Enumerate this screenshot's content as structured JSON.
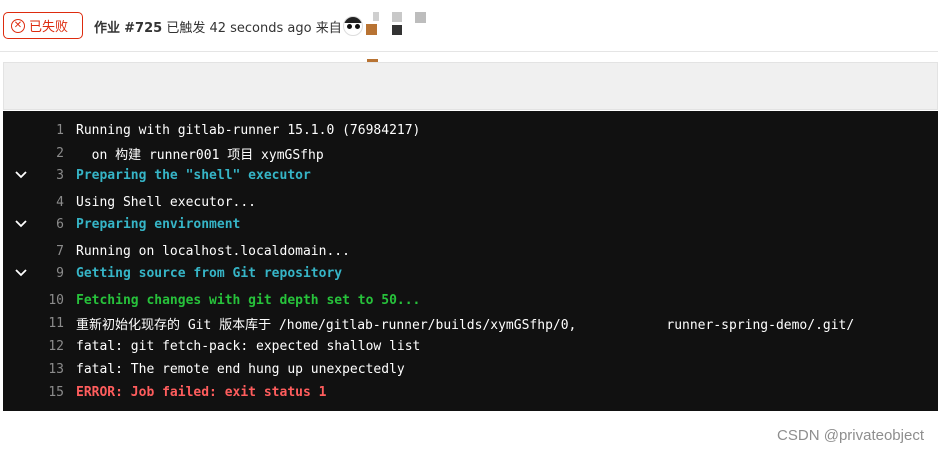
{
  "header": {
    "status_label": "已失败",
    "job_prefix": "作业",
    "job_number": "#725",
    "triggered_text": "已触发 42 seconds ago 来自"
  },
  "log": {
    "lines": [
      {
        "n": "1",
        "text": "Running with gitlab-runner 15.1.0 (76984217)",
        "style": "normal",
        "collapsible": false
      },
      {
        "n": "2",
        "text": "  on 构建 runner001 项目 xymGSfhp",
        "style": "normal",
        "collapsible": false
      },
      {
        "n": "3",
        "text": "Preparing the \"shell\" executor",
        "style": "cyan",
        "collapsible": true
      },
      {
        "n": "4",
        "text": "Using Shell executor...",
        "style": "normal",
        "collapsible": false
      },
      {
        "n": "6",
        "text": "Preparing environment",
        "style": "cyan",
        "collapsible": true
      },
      {
        "n": "7",
        "text": "Running on localhost.localdomain...",
        "style": "normal",
        "collapsible": false
      },
      {
        "n": "9",
        "text": "Getting source from Git repository",
        "style": "cyan",
        "collapsible": true
      },
      {
        "n": "10",
        "text": "Fetching changes with git depth set to 50...",
        "style": "green",
        "collapsible": false
      },
      {
        "n": "11",
        "text_a": "重新初始化现存的 Git 版本库于 /home/gitlab-runner/builds/xymGSfhp/0,",
        "text_b": "runner-spring-demo/.git/",
        "style": "normal",
        "collapsible": false
      },
      {
        "n": "12",
        "text": "fatal: git fetch-pack: expected shallow list",
        "style": "normal",
        "collapsible": false
      },
      {
        "n": "13",
        "text": "fatal: The remote end hung up unexpectedly",
        "style": "normal",
        "collapsible": false
      },
      {
        "n": "15",
        "text": "ERROR: Job failed: exit status 1",
        "style": "red",
        "collapsible": false
      }
    ]
  },
  "watermark": "CSDN @privateobject",
  "colors": {
    "failed": "#dd2b0e",
    "section_header": "#36b5c7",
    "success_text": "#27c23b",
    "error_text": "#ff5d5d",
    "log_background": "#111111"
  }
}
